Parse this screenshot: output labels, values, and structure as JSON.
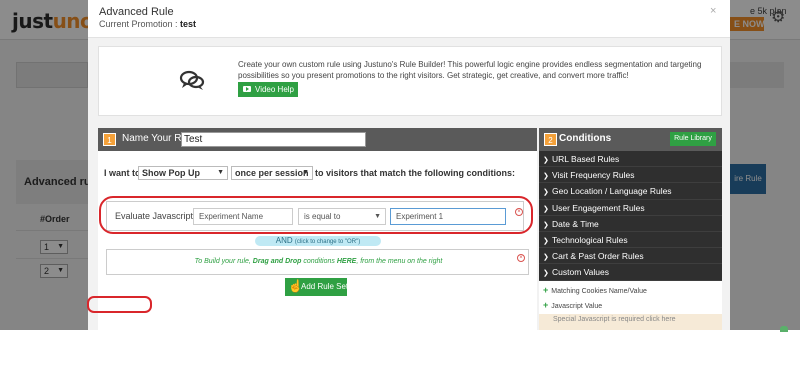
{
  "app": {
    "logo_a": "just",
    "logo_b": "uno",
    "plan_text": "e 5k plan",
    "now_button": "E NOW",
    "bg_heading": "Advanced ru",
    "bg_order_label": "#Order",
    "bg_orders": [
      "1",
      "2"
    ],
    "bg_right_button": "ire Rule"
  },
  "modal": {
    "title": "Advanced Rule",
    "subtitle_label": "Current Promotion :",
    "subtitle_value": "test",
    "close": "×"
  },
  "intro": {
    "text": "Create your own custom rule using Justuno's Rule Builder!   This powerful logic engine provides endless segmentation and targeting possibilities so you present promotions to the right visitors. Get strategic, get creative, and convert more traffic!",
    "video_button": "Video Help"
  },
  "rule": {
    "step": "1",
    "name_label": "Name Your Rule",
    "name_value": "Test",
    "i_want": "I want to",
    "action": "Show Pop Up",
    "frequency": "once per session",
    "visitors_text": "to visitors that match the following conditions:",
    "condition": {
      "label": "Evaluate Javascript",
      "name_placeholder": "Experiment Name",
      "operator": "is equal to",
      "value": "Experiment 1"
    },
    "and_text": "AND",
    "and_hint": "(click to change to \"OR\")",
    "drop_text_1": "To Build your rule,",
    "drop_text_2": "Drag and Drop",
    "drop_text_3": "conditions",
    "drop_text_4": "HERE",
    "drop_text_5": ", from the menu on the right",
    "add_button": "Add Rule Set"
  },
  "conditions": {
    "step": "2",
    "title": "Conditions",
    "library_button": "Rule Library",
    "categories": [
      "URL Based Rules",
      "Visit Frequency Rules",
      "Geo Location / Language Rules",
      "User Engagement Rules",
      "Date & Time",
      "Technological Rules",
      "Cart & Past Order Rules",
      "Custom Values"
    ],
    "custom_items": [
      "Matching Cookies Name/Value",
      "Javascript Value"
    ],
    "special_text": "Special Javascript is required click here"
  },
  "colors": {
    "brand_orange": "#f4912a",
    "green": "#2fa043",
    "highlight_red": "#d9262b",
    "dark_header": "#5a5a5a"
  }
}
